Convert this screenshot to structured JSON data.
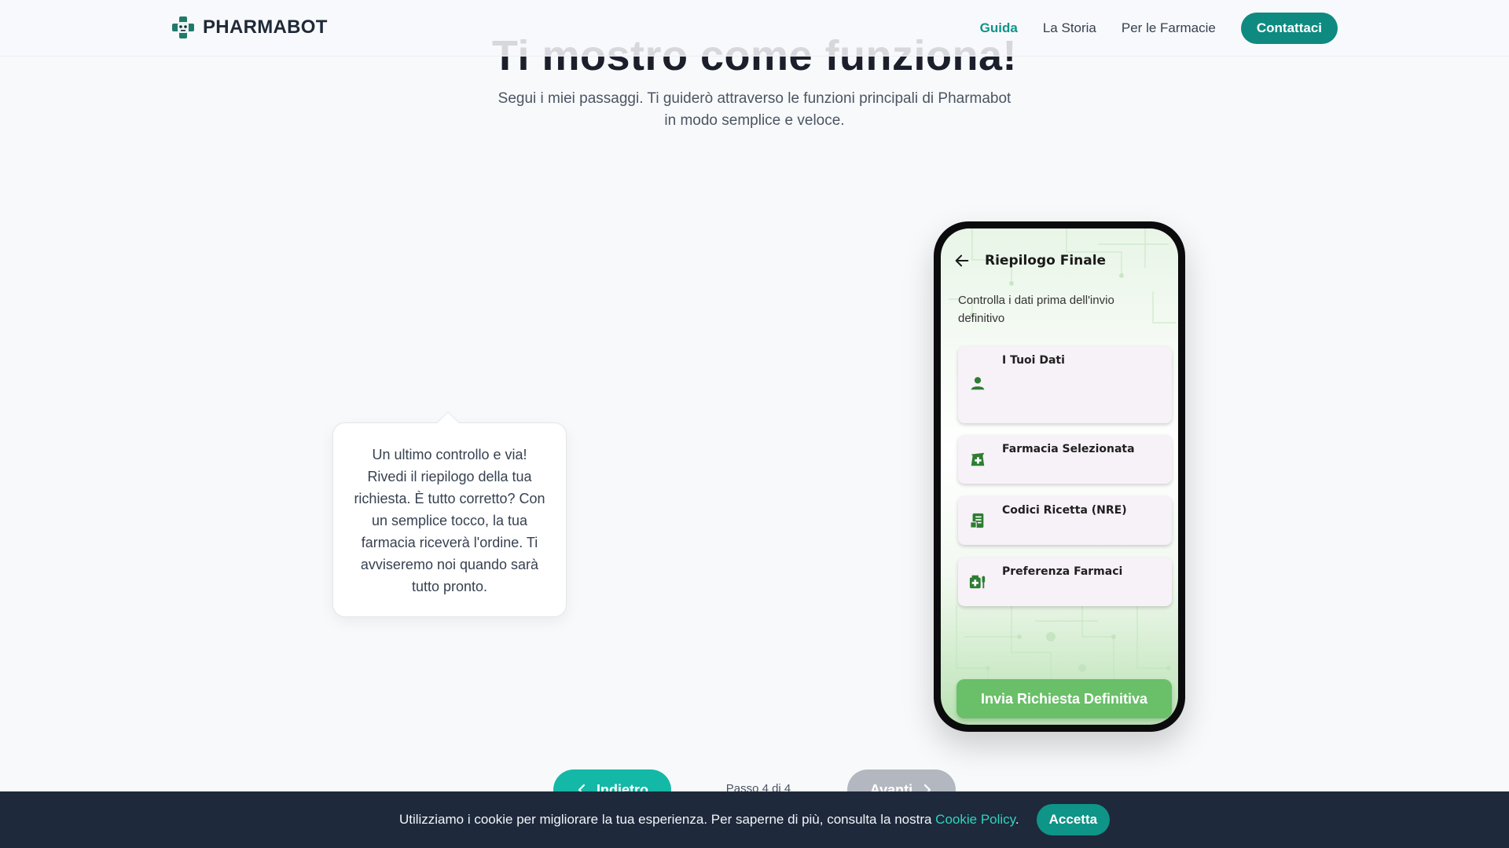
{
  "header": {
    "brand": "PHARMABOT",
    "nav": [
      "Guida",
      "La Storia",
      "Per le Farmacie"
    ],
    "cta": "Contattaci"
  },
  "hero": {
    "title": "Ti mostro come funziona!",
    "subtitle_line1": "Segui i miei passaggi. Ti guiderò attraverso le funzioni principali di Pharmabot",
    "subtitle_line2": "in modo semplice e veloce."
  },
  "bubble": {
    "text": "Un ultimo controllo e via! Rivedi il riepilogo della tua richiesta. È tutto corretto? Con un semplice tocco, la tua farmacia riceverà l'ordine. Ti avviseremo noi quando sarà tutto pronto."
  },
  "phone": {
    "title": "Riepilogo Finale",
    "description": "Controlla i dati prima dell'invio definitivo",
    "cards": [
      {
        "label": "I Tuoi Dati",
        "icon": "person-icon"
      },
      {
        "label": "Farmacia Selezionata",
        "icon": "pharmacy-icon"
      },
      {
        "label": "Codici Ricetta (NRE)",
        "icon": "receipt-icon"
      },
      {
        "label": "Preferenza Farmaci",
        "icon": "medication-icon"
      }
    ],
    "submit": "Invia Richiesta Definitiva"
  },
  "steps": {
    "prev": "Indietro",
    "indicator": "Passo 4 di 4",
    "next": "Avanti"
  },
  "cookie": {
    "text": "Utilizziamo i cookie per migliorare la tua esperienza. Per saperne di più, consulta la nostra ",
    "link": "Cookie Policy",
    "period": ".",
    "accept": "Accetta"
  },
  "colors": {
    "brand": "#0f8a80",
    "accent": "#14b8a6",
    "phone_green": "#6abf69",
    "cookie_bg": "#1e293b"
  }
}
